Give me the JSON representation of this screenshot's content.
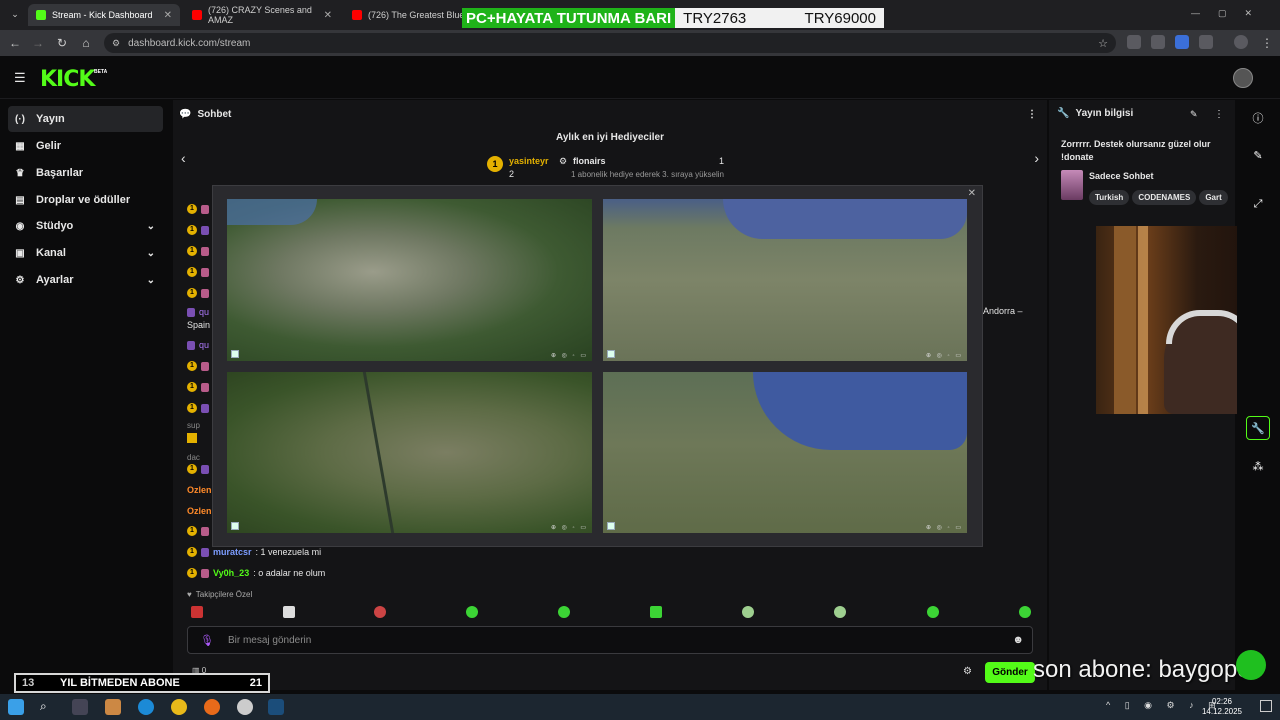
{
  "browser": {
    "tabs": [
      {
        "label": "Stream - Kick Dashboard",
        "active": true
      },
      {
        "label": "(726) CRAZY Scenes and AMAZ",
        "active": false
      },
      {
        "label": "(726) The Greatest Blues Ba",
        "active": false
      }
    ],
    "url": "dashboard.kick.com/stream"
  },
  "overlay": {
    "banner_left": "PC+HAYATA TUTUNMA BARI",
    "banner_mid": "TRY2763",
    "banner_right": "TRY69000",
    "abone_count": "13",
    "abone_text": "YIL BİTMEDEN ABONE",
    "abone_goal": "21",
    "son_abone": "son abone: baygopo"
  },
  "kick": {
    "logo": "KICK",
    "beta": "BETA"
  },
  "sidebar": {
    "items": [
      {
        "label": "Yayın",
        "icon": "broadcast-icon"
      },
      {
        "label": "Gelir",
        "icon": "revenue-icon"
      },
      {
        "label": "Başarılar",
        "icon": "trophy-icon"
      },
      {
        "label": "Droplar ve ödüller",
        "icon": "drops-icon"
      },
      {
        "label": "Stüdyo",
        "icon": "studio-icon"
      },
      {
        "label": "Kanal",
        "icon": "channel-icon"
      },
      {
        "label": "Ayarlar",
        "icon": "settings-icon"
      }
    ]
  },
  "chat": {
    "title": "Sohbet",
    "gifters_title": "Aylık en iyi Hediyeciler",
    "first_name": "yasinteyr",
    "first_count": "2",
    "second_name": "flonairs",
    "second_count": "1",
    "hint": "1 abonelik hediye ederek 3. sıraya yükselin",
    "snippets": {
      "spain": "Spain",
      "andorra": "a Andorra –",
      "sup": "sup",
      "dac": "dac",
      "ozlem1": "Ozlen",
      "ozlem2": "Ozlen"
    },
    "messages": [
      {
        "user": "muratcsr",
        "text": ": 1 venezuela mi"
      },
      {
        "user": "Vy0h_23",
        "text": ": o adalar ne olum"
      }
    ],
    "followers_only": "Takipçilere Özel",
    "input_placeholder": "Bir mesaj gönderin",
    "send_label": "Gönder",
    "gift_count": "0"
  },
  "info": {
    "title": "Yayın bilgisi",
    "stream_title": "Zorrrrr. Destek olursanız güzel olur !donate",
    "category": "Sadece Sohbet",
    "tags": [
      "Turkish",
      "CODENAMES",
      "Gart"
    ]
  },
  "taskbar": {
    "time": "02:26",
    "date": "14.12.2025"
  },
  "colors": {
    "kick_green": "#53fc18",
    "panel": "#141416"
  }
}
